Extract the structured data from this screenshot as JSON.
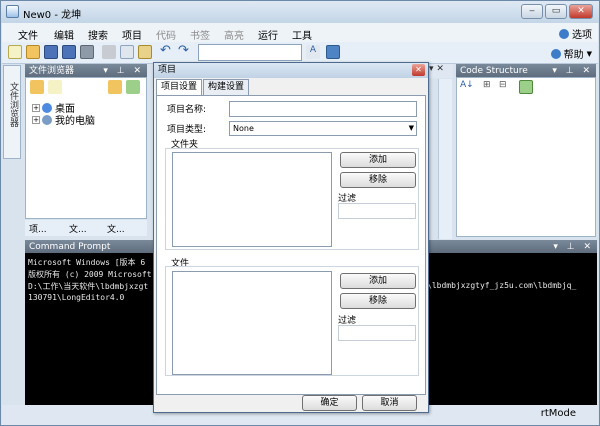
{
  "window": {
    "title": "New0 - 龙坤",
    "controls": [
      "‒",
      "▭",
      "✕"
    ]
  },
  "menu": {
    "items": [
      "文件",
      "编辑",
      "搜索",
      "项目",
      "代码",
      "书签",
      "高亮",
      "运行",
      "工具"
    ],
    "options": "选项",
    "help": "帮助"
  },
  "side_tab": "文件浏览器",
  "file_browser": {
    "title": "文件浏览器",
    "tree": [
      "桌面",
      "我的电脑"
    ],
    "tabs": [
      "项...",
      "文...",
      "文..."
    ]
  },
  "code_structure": {
    "title": "Code Structure"
  },
  "command_prompt": {
    "title": "Command Prompt",
    "lines": [
      "Microsoft Windows [版本 6",
      "版权所有 (c) 2009 Microsoft",
      "D:\\工作\\当天软件\\lbdmbjxzgt",
      "130791\\LongEditor4.0"
    ],
    "tail": "\\lbdmbjxzgtyf_jz5u.com\\lbdmbjq_"
  },
  "status": {
    "mode": "rtMode"
  },
  "dialog": {
    "title": "项目",
    "tabs": [
      "项目设置",
      "构建设置"
    ],
    "name_label": "项目名称:",
    "name_value": "",
    "type_label": "项目类型:",
    "type_value": "None",
    "folder_group": "文件夹",
    "file_group": "文件",
    "add": "添加",
    "remove": "移除",
    "filter": "过滤",
    "ok": "确定",
    "cancel": "取消"
  }
}
